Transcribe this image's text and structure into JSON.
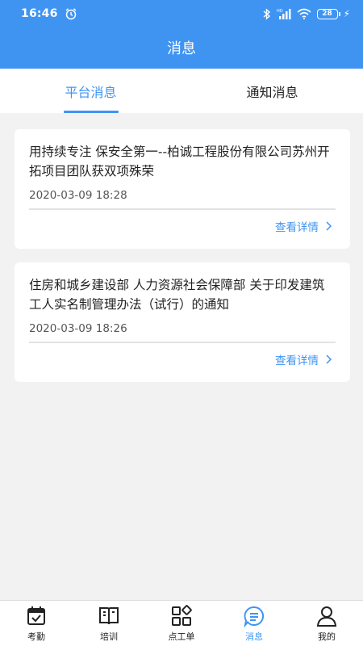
{
  "status_bar": {
    "time": "16:46",
    "battery": "28"
  },
  "header": {
    "title": "消息"
  },
  "tabs": [
    {
      "label": "平台消息",
      "active": true
    },
    {
      "label": "通知消息",
      "active": false
    }
  ],
  "messages": [
    {
      "title": "用持续专注 保安全第一--柏诚工程股份有限公司苏州开拓项目团队获双项殊荣",
      "time": "2020-03-09 18:28",
      "link": "查看详情"
    },
    {
      "title": "住房和城乡建设部 人力资源社会保障部 关于印发建筑工人实名制管理办法（试行）的通知",
      "time": "2020-03-09 18:26",
      "link": "查看详情"
    }
  ],
  "bottom_nav": [
    {
      "label": "考勤",
      "icon": "calendar-check-icon"
    },
    {
      "label": "培训",
      "icon": "book-icon"
    },
    {
      "label": "点工单",
      "icon": "grid-apps-icon"
    },
    {
      "label": "消息",
      "icon": "message-icon",
      "active": true
    },
    {
      "label": "我的",
      "icon": "user-icon"
    }
  ],
  "colors": {
    "accent": "#3f94f2",
    "background": "#f2f2f2"
  }
}
